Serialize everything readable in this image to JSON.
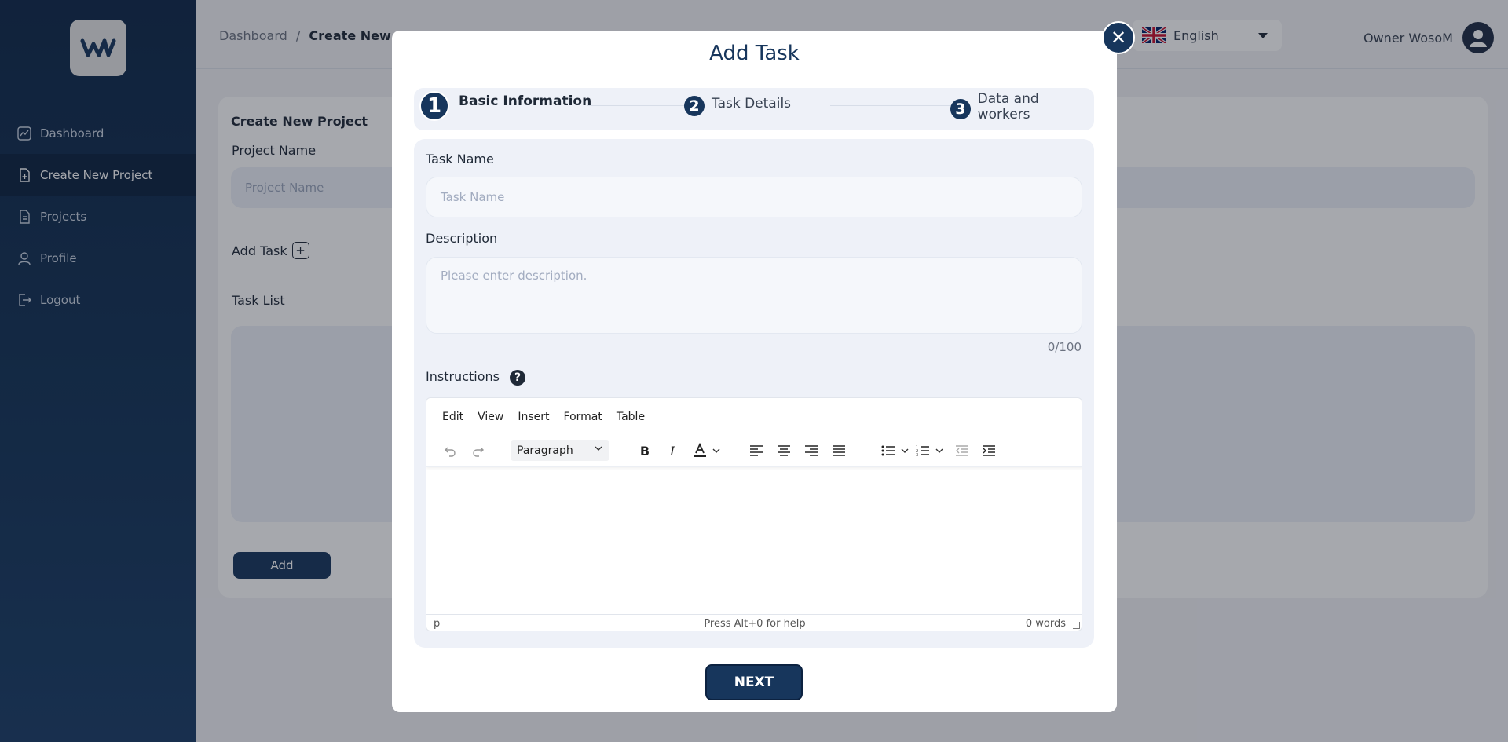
{
  "sidebar": {
    "items": [
      {
        "label": "Dashboard",
        "icon": "chart-icon"
      },
      {
        "label": "Create New Project",
        "icon": "file-plus-icon"
      },
      {
        "label": "Projects",
        "icon": "file-icon"
      },
      {
        "label": "Profile",
        "icon": "user-icon"
      },
      {
        "label": "Logout",
        "icon": "logout-icon"
      }
    ],
    "active_index": 1
  },
  "header": {
    "breadcrumb_root": "Dashboard",
    "breadcrumb_sep": "/",
    "breadcrumb_current": "Create New Project",
    "language": "English",
    "user_name": "Owner WosoM"
  },
  "page": {
    "card_title": "Create New Project",
    "project_name_label": "Project Name",
    "project_name_placeholder": "Project Name",
    "add_task_label": "Add Task",
    "task_list_label": "Task List",
    "add_button": "Add"
  },
  "modal": {
    "title": "Add Task",
    "steps": [
      {
        "num": "1",
        "label": "Basic Information",
        "active": true
      },
      {
        "num": "2",
        "label": "Task Details",
        "active": false
      },
      {
        "num": "3",
        "label": "Data and workers",
        "active": false
      }
    ],
    "task_name_label": "Task Name",
    "task_name_placeholder": "Task Name",
    "description_label": "Description",
    "description_placeholder": "Please enter description.",
    "description_counter": "0/100",
    "instructions_label": "Instructions",
    "editor": {
      "menus": [
        "Edit",
        "View",
        "Insert",
        "Format",
        "Table"
      ],
      "block_format": "Paragraph",
      "status_path": "p",
      "status_help": "Press Alt+0 for help",
      "word_count": "0 words"
    },
    "next_button": "NEXT"
  },
  "colors": {
    "primary": "#17365c",
    "sidebar": "#0f2849",
    "field_bg": "#eef1f8"
  }
}
